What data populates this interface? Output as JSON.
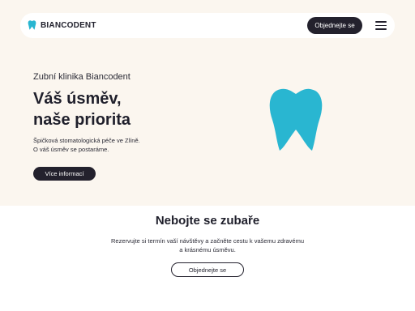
{
  "header": {
    "brand_name": "BIANCODENT",
    "logo_icon": "tooth-logo-icon",
    "cta_label": "Objednejte se",
    "menu_icon": "hamburger-menu-icon"
  },
  "hero": {
    "eyebrow": "Zubní klinika Biancodent",
    "headline_line1": "Váš úsměv,",
    "headline_line2": "naše priorita",
    "description_line1": "Špičková stomatologická péče ve Zlíně.",
    "description_line2": "O váš úsměv se postaráme.",
    "button_label": "Více informací",
    "illustration_icon": "tooth-illustration"
  },
  "section": {
    "title": "Nebojte se zubaře",
    "text_line1": "Rezervujte si termín vaší návštěvy a začněte cestu k vašemu zdravému",
    "text_line2": "a krásnému úsměvu.",
    "button_label": "Objednejte se"
  },
  "colors": {
    "hero_background": "#fbf6ef",
    "dark": "#23212d",
    "accent": "#29b6d1"
  }
}
